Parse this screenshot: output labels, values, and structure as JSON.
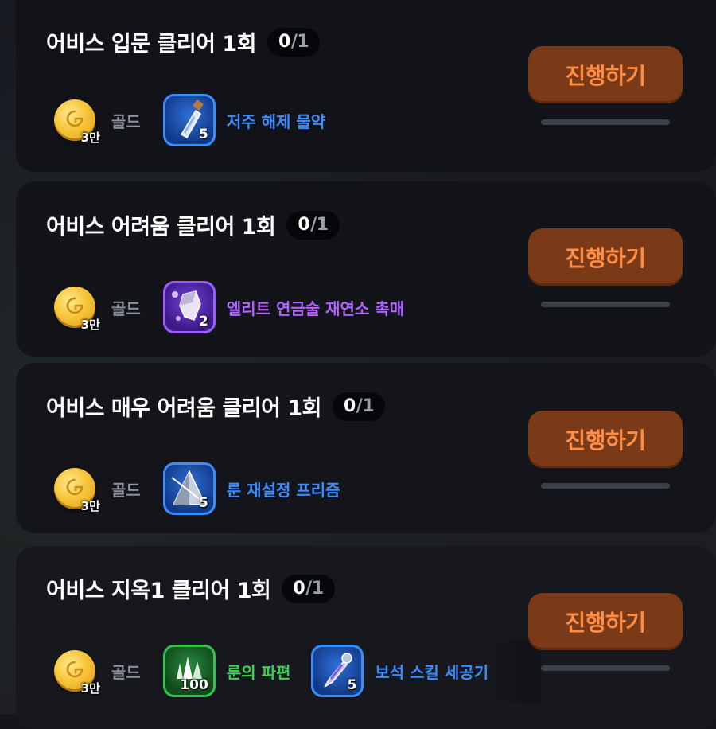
{
  "quests": [
    {
      "title": "어비스 입문 클리어 1회",
      "progress_current": "0",
      "progress_total": "/1",
      "gold_amount": "3만",
      "gold_label": "골드",
      "rewards": [
        {
          "name": "저주 해제 물약",
          "count": "5",
          "rarity": "blue",
          "icon": "potion-icon"
        }
      ],
      "button_label": "진행하기"
    },
    {
      "title": "어비스 어려움 클리어 1회",
      "progress_current": "0",
      "progress_total": "/1",
      "gold_amount": "3만",
      "gold_label": "골드",
      "rewards": [
        {
          "name": "엘리트 연금술 재연소 촉매",
          "count": "2",
          "rarity": "purple",
          "icon": "crystal-catalyst-icon"
        }
      ],
      "button_label": "진행하기"
    },
    {
      "title": "어비스 매우 어려움 클리어 1회",
      "progress_current": "0",
      "progress_total": "/1",
      "gold_amount": "3만",
      "gold_label": "골드",
      "rewards": [
        {
          "name": "룬 재설정 프리즘",
          "count": "5",
          "rarity": "blue",
          "icon": "prism-icon"
        }
      ],
      "button_label": "진행하기"
    },
    {
      "title": "어비스 지옥1 클리어 1회",
      "progress_current": "0",
      "progress_total": "/1",
      "gold_amount": "3만",
      "gold_label": "골드",
      "rewards": [
        {
          "name": "룬의 파편",
          "count": "100",
          "rarity": "green",
          "icon": "rune-shard-icon"
        },
        {
          "name": "보석 스킬 세공기",
          "count": "5",
          "rarity": "blue",
          "icon": "gem-tool-icon"
        }
      ],
      "button_label": "진행하기"
    }
  ],
  "colors": {
    "button_bg": "#7a3a17",
    "button_text": "#ff8d43",
    "rarity_blue": "#3d8cff",
    "rarity_purple": "#b063ff",
    "rarity_green": "#3fcf55"
  }
}
